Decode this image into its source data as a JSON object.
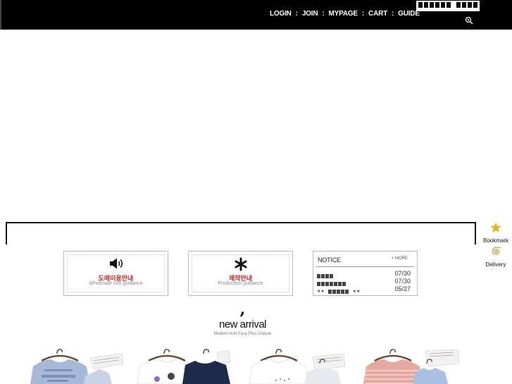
{
  "topnav": {
    "items": [
      "LOGIN",
      "JOIN",
      "MYPAGE",
      "CART",
      "GUIDE"
    ],
    "separator": ":"
  },
  "search": {
    "icon": "zoom-in-icon"
  },
  "quick_menu": {
    "bookmark": {
      "label": "Bookmark",
      "icon": "star-icon",
      "color": "#e8b21a"
    },
    "delivery": {
      "label": "Delivery",
      "icon": "swirl-icon",
      "color": "#b8a23a"
    }
  },
  "guides": [
    {
      "title_kr": "도매이용안내",
      "title_en": "Wholesale use guidance",
      "icon": "speaker-icon"
    },
    {
      "title_kr": "제작안내",
      "title_en": "Production guidance",
      "icon": "asterisk-icon"
    }
  ],
  "notice": {
    "title": "NOTICE",
    "more": "+ MORE",
    "items": [
      {
        "date": "07/30"
      },
      {
        "date": "07/30"
      },
      {
        "date": "05/27"
      }
    ]
  },
  "arrival": {
    "mark": ",",
    "title": "new arrival",
    "subtitle": "Modern And Easy Plus Unique"
  },
  "products": [
    {
      "name": "product-1",
      "colors": [
        "#9fb3d6",
        "#c9d3e6"
      ]
    },
    {
      "name": "product-2",
      "colors": [
        "#ffffff",
        "#1f2b4d"
      ]
    },
    {
      "name": "product-3",
      "colors": [
        "#ffffff",
        "#e8e8ef"
      ]
    },
    {
      "name": "product-4",
      "colors": [
        "#e6a9a0",
        "#aac0e0"
      ]
    }
  ],
  "colors": {
    "accent_red": "#d01c1c",
    "bar": "#000000"
  }
}
